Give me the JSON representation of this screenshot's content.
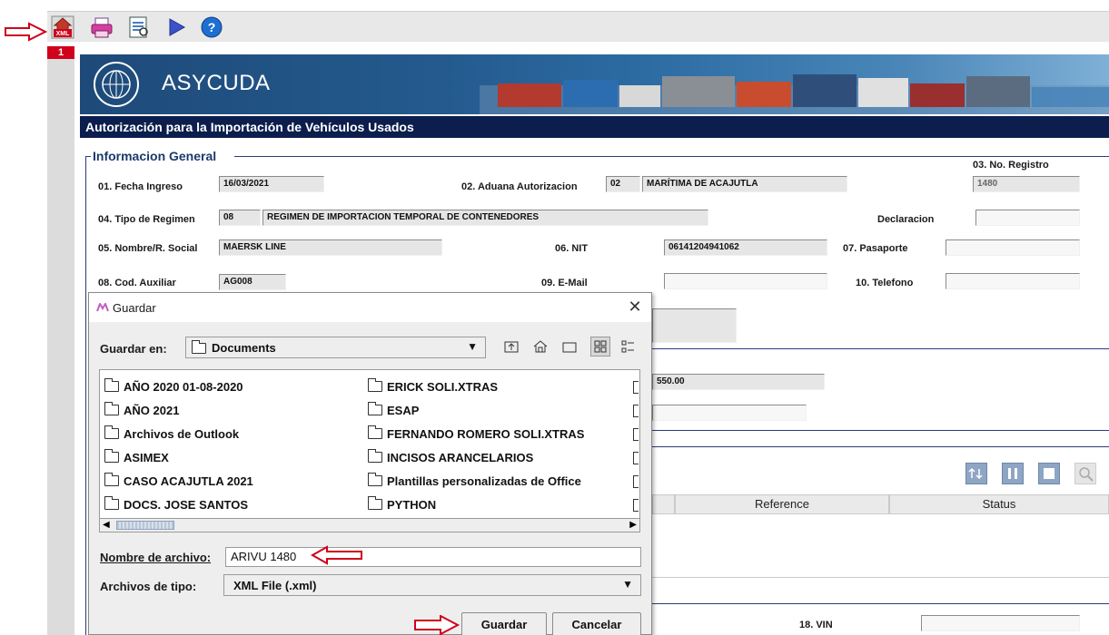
{
  "toolbar": {
    "icons": [
      "xml-export-icon",
      "print-icon",
      "preview-icon",
      "play-icon",
      "help-icon"
    ],
    "xml_label": "XML"
  },
  "tab": {
    "number": "1"
  },
  "banner": {
    "title": "ASYCUDA"
  },
  "form": {
    "title": "Autorización para la Importación de Vehículos Usados",
    "section_general": "Informacion General",
    "f01_label": "01. Fecha Ingreso",
    "f01_value": "16/03/2021",
    "f02_label": "02. Aduana Autorizacion",
    "f02_code": "02",
    "f02_value": "MARÍTIMA DE ACAJUTLA",
    "f03_label": "03. No. Registro",
    "f03_value": "1480",
    "f04_label": "04. Tipo de Regimen",
    "f04_code": "08",
    "f04_value": "REGIMEN DE IMPORTACION TEMPORAL DE CONTENEDORES",
    "declaracion_label": "Declaracion",
    "declaracion_value": "",
    "f05_label": "05. Nombre/R. Social",
    "f05_value": "MAERSK LINE",
    "f06_label": "06. NIT",
    "f06_value": "06141204941062",
    "f07_label": "07. Pasaporte",
    "f07_value": "",
    "f08_label": "08. Cod. Auxiliar",
    "f08_value": "AG008",
    "f09_label": "09. E-Mail",
    "f09_value": "",
    "f10_label": "10. Telefono",
    "f10_value": "",
    "amount_value": "550.00",
    "grid_reference": "Reference",
    "grid_status": "Status",
    "f18_label": "18. VIN",
    "f18_value": ""
  },
  "dialog": {
    "title": "Guardar",
    "save_in_label": "Guardar en:",
    "save_in_value": "Documents",
    "files_col1": [
      "AÑO 2020 01-08-2020",
      "AÑO 2021",
      "Archivos de Outlook",
      "ASIMEX",
      "CASO ACAJUTLA 2021",
      "DOCS. JOSE SANTOS"
    ],
    "files_col2": [
      "ERICK SOLI.XTRAS",
      "ESAP",
      "FERNANDO ROMERO SOLI.XTRAS",
      "INCISOS ARANCELARIOS",
      "Plantillas personalizadas de Office",
      "PYTHON"
    ],
    "filename_label": "Nombre de archivo:",
    "filename_value": "ARIVU 1480",
    "filetype_label": "Archivos de tipo:",
    "filetype_value": "XML File (.xml)",
    "save_button": "Guardar",
    "cancel_button": "Cancelar"
  },
  "colors": {
    "annotation_arrow": "#d0021b",
    "header_bar": "#0b1e4d",
    "section_text": "#1a3a6b"
  }
}
